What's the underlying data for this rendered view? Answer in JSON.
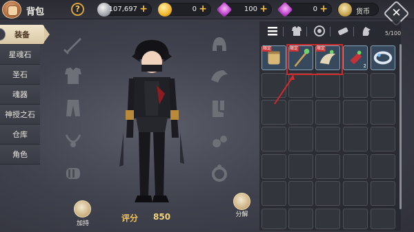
{
  "header": {
    "title": "背包",
    "help_label": "?",
    "silver": "107,697",
    "gold": "0",
    "gem_a": "100",
    "gem_b": "0",
    "currency_button": "货币",
    "close_label": "✕"
  },
  "sidebar": {
    "items": [
      {
        "label": "装备",
        "active": true
      },
      {
        "label": "星魂石",
        "active": false
      },
      {
        "label": "圣石",
        "active": false
      },
      {
        "label": "魂器",
        "active": false
      },
      {
        "label": "神授之石",
        "active": false
      },
      {
        "label": "仓库",
        "active": false
      },
      {
        "label": "角色",
        "active": false
      }
    ]
  },
  "equipment": {
    "left_slots": [
      "sword-icon",
      "armor-icon",
      "pants-icon",
      "necklace-icon",
      "bracer-icon"
    ],
    "right_slots": [
      "helmet-icon",
      "shoulder-icon",
      "boots-icon",
      "earring-icon",
      "ring-icon"
    ]
  },
  "footer": {
    "enhance_label": "加持",
    "score_label": "评分",
    "score_value": "850",
    "decompose_label": "分解"
  },
  "inventory": {
    "categories": [
      "list-icon",
      "armor-category-icon",
      "accessory-category-icon",
      "scroll-category-icon",
      "mount-category-icon"
    ],
    "count": "5/100",
    "items": [
      {
        "name": "scroll-item",
        "tag": "限定",
        "badge": ""
      },
      {
        "name": "staff-item",
        "tag": "限定",
        "badge": ""
      },
      {
        "name": "horn-item",
        "tag": "限定",
        "badge": ""
      },
      {
        "name": "gem-item",
        "tag": "",
        "badge": "2"
      },
      {
        "name": "ring-item",
        "tag": "",
        "badge": ""
      }
    ]
  },
  "colors": {
    "accent_gold": "#f0c35a",
    "highlight_red": "#d32a2a",
    "active_tab": "#f0e5cc"
  }
}
